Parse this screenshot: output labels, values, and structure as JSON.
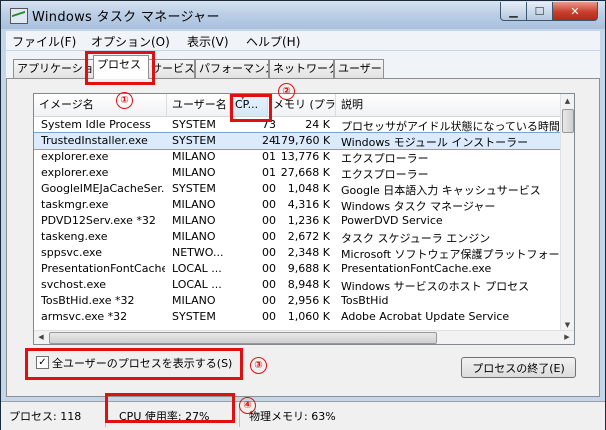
{
  "window": {
    "title": "Windows タスク マネージャー"
  },
  "menu": [
    "ファイル(F)",
    "オプション(O)",
    "表示(V)",
    "ヘルプ(H)"
  ],
  "tabs": [
    "アプリケーション",
    "プロセス",
    "サービス",
    "パフォーマンス",
    "ネットワーク",
    "ユーザー"
  ],
  "columns": [
    "イメージ名",
    "ユーザー名",
    "CP...",
    "メモリ (プラ...",
    "説明"
  ],
  "processes": [
    {
      "name": "System Idle Process",
      "user": "SYSTEM",
      "cpu": "73",
      "mem": "24 K",
      "desc": "プロセッサがアイドル状態になっている時間 (パー"
    },
    {
      "name": "TrustedInstaller.exe",
      "user": "SYSTEM",
      "cpu": "24",
      "mem": "179,760 K",
      "desc": "Windows モジュール インストーラー"
    },
    {
      "name": "explorer.exe",
      "user": "MILANO",
      "cpu": "01",
      "mem": "13,776 K",
      "desc": "エクスプローラー"
    },
    {
      "name": "explorer.exe",
      "user": "MILANO",
      "cpu": "01",
      "mem": "27,668 K",
      "desc": "エクスプローラー"
    },
    {
      "name": "GoogleIMEJaCacheSer...",
      "user": "SYSTEM",
      "cpu": "00",
      "mem": "1,048 K",
      "desc": "Google 日本語入力 キャッシュサービス"
    },
    {
      "name": "taskmgr.exe",
      "user": "MILANO",
      "cpu": "00",
      "mem": "4,316 K",
      "desc": "Windows タスク マネージャー"
    },
    {
      "name": "PDVD12Serv.exe *32",
      "user": "MILANO",
      "cpu": "00",
      "mem": "1,236 K",
      "desc": "PowerDVD Service"
    },
    {
      "name": "taskeng.exe",
      "user": "MILANO",
      "cpu": "00",
      "mem": "2,672 K",
      "desc": "タスク スケジューラ エンジン"
    },
    {
      "name": "sppsvc.exe",
      "user": "NETWO...",
      "cpu": "00",
      "mem": "2,348 K",
      "desc": "Microsoft ソフトウェア保護プラットフォーム サー"
    },
    {
      "name": "PresentationFontCache...",
      "user": "LOCAL ...",
      "cpu": "00",
      "mem": "9,688 K",
      "desc": "PresentationFontCache.exe"
    },
    {
      "name": "svchost.exe",
      "user": "LOCAL ...",
      "cpu": "00",
      "mem": "8,948 K",
      "desc": "Windows サービスのホスト プロセス"
    },
    {
      "name": "TosBtHid.exe *32",
      "user": "MILANO",
      "cpu": "00",
      "mem": "2,956 K",
      "desc": "TosBtHid"
    },
    {
      "name": "armsvc.exe *32",
      "user": "SYSTEM",
      "cpu": "00",
      "mem": "1,060 K",
      "desc": "Adobe Acrobat Update Service"
    }
  ],
  "show_all_users": {
    "label": "全ユーザーのプロセスを表示する(S)",
    "checked": true
  },
  "end_process_label": "プロセスの終了(E)",
  "status": {
    "processes": "プロセス: 118",
    "cpu": "CPU 使用率: 27%",
    "memory": "物理メモリ: 63%"
  },
  "annotations": [
    "①",
    "②",
    "③",
    "④"
  ],
  "highlight_color": "#e01010",
  "selected_row": 1
}
